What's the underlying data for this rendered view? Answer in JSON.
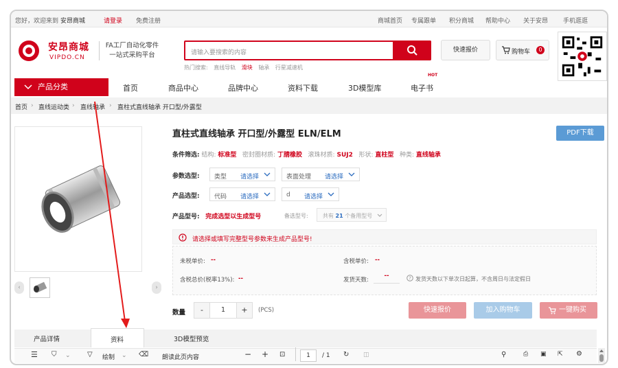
{
  "topbar": {
    "greeting": "您好，欢迎来到",
    "site": "安昂商城",
    "login": "请登录",
    "register": "免费注册",
    "links": [
      "商城首页",
      "专属跟单",
      "积分商城",
      "帮助中心",
      "关于安昂",
      "手机逛逛"
    ]
  },
  "brand": {
    "name": "安昂商城",
    "domain": "VIPDO.CN",
    "slogan1": "FA工厂自动化零件",
    "slogan2": "一站式采购平台"
  },
  "search": {
    "placeholder": "请输入要搜索的内容",
    "hot_label": "热门搜索:",
    "hot": [
      "直线导轨",
      "滑块",
      "轴承",
      "行星减速机"
    ]
  },
  "quote_btn": "快速报价",
  "cart": {
    "label": "购物车",
    "count": "0"
  },
  "nav": {
    "category": "产品分类",
    "items": [
      "首页",
      "商品中心",
      "品牌中心",
      "资料下载",
      "3D模型库",
      "电子书"
    ],
    "hot_tag": "HOT"
  },
  "breadcrumb": [
    "首页",
    "直线运动类",
    "直线轴承",
    "直柱式直线轴承 开口型/外露型"
  ],
  "product": {
    "title": "直柱式直线轴承 开口型/外露型  ELN/ELM",
    "pdf_btn": "PDF下载",
    "filter_label": "条件筛选:",
    "filters": [
      {
        "k": "结构:",
        "v": "标准型"
      },
      {
        "k": "密封圈材质:",
        "v": "丁腈橡胶"
      },
      {
        "k": "滚珠材质:",
        "v": "SUJ2"
      },
      {
        "k": "形状:",
        "v": "直柱型"
      },
      {
        "k": "种类:",
        "v": "直线轴承"
      }
    ],
    "param_label": "参数选型:",
    "param_sel": [
      {
        "k": "类型",
        "v": "请选择"
      },
      {
        "k": "表面处理",
        "v": "请选择"
      }
    ],
    "prod_label": "产品选型:",
    "prod_sel": [
      {
        "k": "代码",
        "v": "请选择"
      },
      {
        "k": "d",
        "v": "请选择"
      }
    ],
    "model_label": "产品型号:",
    "model_hint": "完成选型以生成型号",
    "backup_label": "备选型号:",
    "backup_pre": "共有",
    "backup_count": "21",
    "backup_post": "个备用型号",
    "alert": "请选择或填写完整型号参数来生成产品型号!",
    "price": {
      "unit_ex": "未税单价:",
      "unit_in": "含税单价:",
      "total": "含税总价(税率13%):",
      "ship": "发货天数:",
      "dash": "--",
      "ship_note": "发货天数以下单次日起算，不含周日与法定假日"
    },
    "qty_label": "数量",
    "qty": "1",
    "minus": "-",
    "plus": "+",
    "unit": "(PCS)",
    "btn_quote": "快速报价",
    "btn_cart": "加入购物车",
    "btn_buy": "一键购买"
  },
  "tabs": [
    "产品详情",
    "资料",
    "3D模型预览"
  ],
  "pdfbar": {
    "draw": "绘制",
    "read": "朗读此页内容",
    "page": "1",
    "total": "/ 1"
  },
  "colors": {
    "accent": "#d0021b",
    "blue": "#5b9bd5"
  }
}
